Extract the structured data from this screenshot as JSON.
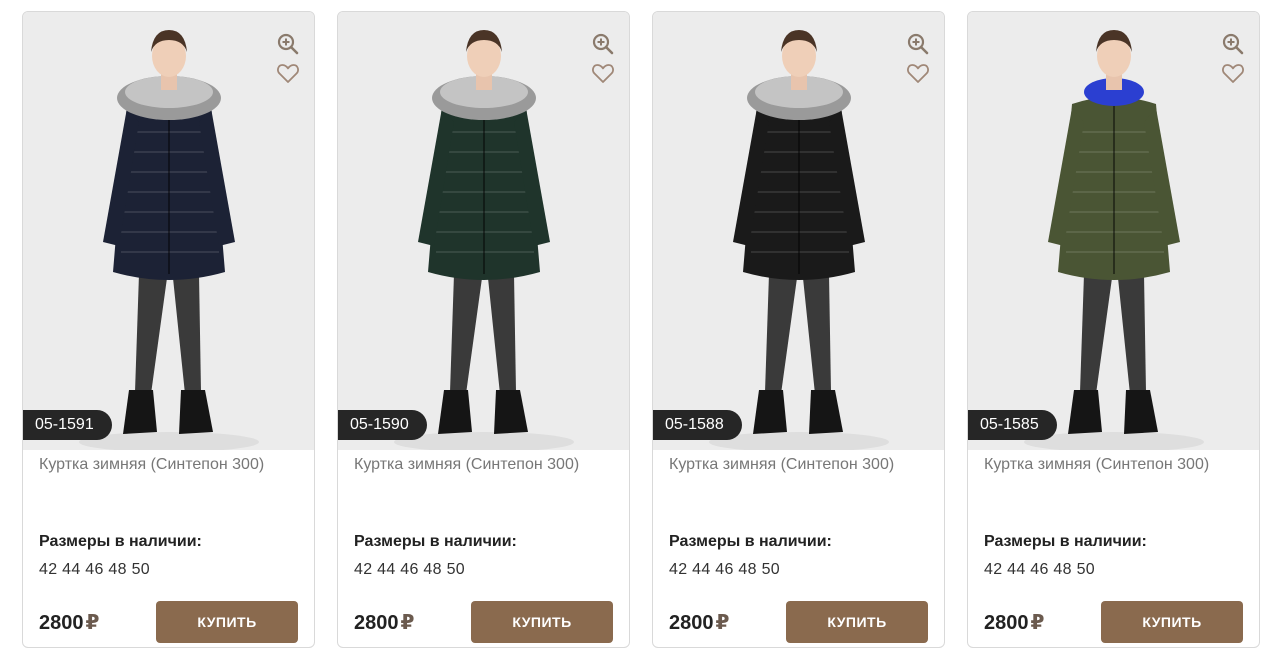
{
  "products": [
    {
      "sku": "05-1591",
      "title": "Куртка зимняя (Синтепон 300)",
      "sizes_label": "Размеры в наличии:",
      "sizes": "42 44 46 48 50",
      "price": "2800",
      "currency": "₽",
      "buy_label": "КУПИТЬ",
      "coat_color": "#1c2235",
      "lining_color": "#2b3fd1",
      "fur": true
    },
    {
      "sku": "05-1590",
      "title": "Куртка зимняя (Синтепон 300)",
      "sizes_label": "Размеры в наличии:",
      "sizes": "42 44 46 48 50",
      "price": "2800",
      "currency": "₽",
      "buy_label": "КУПИТЬ",
      "coat_color": "#1f342b",
      "lining_color": "#1a1a1a",
      "fur": true
    },
    {
      "sku": "05-1588",
      "title": "Куртка зимняя (Синтепон 300)",
      "sizes_label": "Размеры в наличии:",
      "sizes": "42 44 46 48 50",
      "price": "2800",
      "currency": "₽",
      "buy_label": "КУПИТЬ",
      "coat_color": "#1a1a1a",
      "lining_color": "#2b3fd1",
      "fur": true
    },
    {
      "sku": "05-1585",
      "title": "Куртка зимняя (Синтепон 300)",
      "sizes_label": "Размеры в наличии:",
      "sizes": "42 44 46 48 50",
      "price": "2800",
      "currency": "₽",
      "buy_label": "КУПИТЬ",
      "coat_color": "#4a5534",
      "lining_color": "#2b3fd1",
      "fur": false
    }
  ],
  "icons": {
    "zoom": "zoom-in-icon",
    "favorite": "heart-icon"
  },
  "colors": {
    "button": "#8a6a4e",
    "sku_badge": "#262626",
    "photo_bg": "#ececec"
  }
}
